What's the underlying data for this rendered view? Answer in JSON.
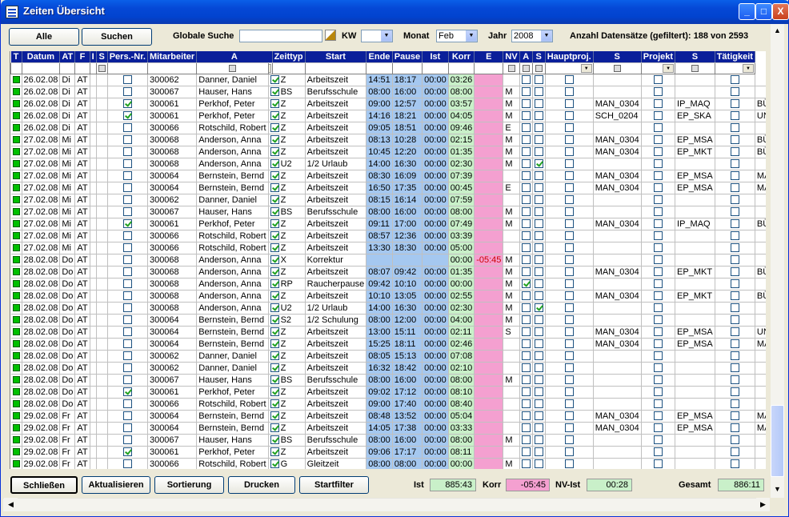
{
  "window": {
    "title": "Zeiten Übersicht",
    "minimize": "_",
    "maximize": "□",
    "close": "X"
  },
  "toolbar": {
    "alle": "Alle",
    "suchen": "Suchen",
    "global_search_label": "Globale Suche",
    "global_search_value": "",
    "kw_label": "KW",
    "kw_value": "",
    "monat_label": "Monat",
    "monat_value": "Feb",
    "jahr_label": "Jahr",
    "jahr_value": "2008",
    "count_text": "Anzahl Datensätze (gefiltert): 188 von 2593"
  },
  "columns": [
    "T",
    "Datum",
    "AT",
    "F",
    "I",
    "S",
    "Pers.-Nr.",
    "Mitarbeiter",
    "A",
    "",
    "Zeittyp",
    "Start",
    "Ende",
    "Pause",
    "Ist",
    "Korr",
    "E",
    "NV",
    "A",
    "S",
    "Hauptproj.",
    "S",
    "Projekt",
    "S",
    "Tätigkeit"
  ],
  "rows": [
    [
      "26.02.08",
      "Di",
      "AT",
      "",
      false,
      "300062",
      "Danner, Daniel",
      true,
      "Z",
      "Arbeitszeit",
      "14:51",
      "18:17",
      "00:00",
      "03:26",
      "",
      "",
      false,
      false,
      false,
      "",
      false,
      "",
      false,
      ""
    ],
    [
      "26.02.08",
      "Di",
      "AT",
      "",
      false,
      "300067",
      "Hauser, Hans",
      true,
      "BS",
      "Berufsschule",
      "08:00",
      "16:00",
      "00:00",
      "08:00",
      "",
      "M",
      false,
      false,
      false,
      "",
      false,
      "",
      false,
      ""
    ],
    [
      "26.02.08",
      "Di",
      "AT",
      "",
      true,
      "300061",
      "Perkhof, Peter",
      true,
      "Z",
      "Arbeitszeit",
      "09:00",
      "12:57",
      "00:00",
      "03:57",
      "",
      "M",
      false,
      false,
      false,
      "MAN_0304",
      false,
      "IP_MAQ",
      false,
      "BÜRO"
    ],
    [
      "26.02.08",
      "Di",
      "AT",
      "",
      true,
      "300061",
      "Perkhof, Peter",
      true,
      "Z",
      "Arbeitszeit",
      "14:16",
      "18:21",
      "00:00",
      "04:05",
      "",
      "M",
      false,
      false,
      false,
      "SCH_0204",
      false,
      "EP_SKA",
      false,
      "UNP"
    ],
    [
      "26.02.08",
      "Di",
      "AT",
      "",
      false,
      "300066",
      "Rotschild, Robert",
      true,
      "Z",
      "Arbeitszeit",
      "09:05",
      "18:51",
      "00:00",
      "09:46",
      "",
      "E",
      false,
      false,
      false,
      "",
      false,
      "",
      false,
      ""
    ],
    [
      "27.02.08",
      "Mi",
      "AT",
      "",
      false,
      "300068",
      "Anderson, Anna",
      true,
      "Z",
      "Arbeitszeit",
      "08:13",
      "10:28",
      "00:00",
      "02:15",
      "",
      "M",
      false,
      false,
      false,
      "MAN_0304",
      false,
      "EP_MSA",
      false,
      "BÜRO"
    ],
    [
      "27.02.08",
      "Mi",
      "AT",
      "",
      false,
      "300068",
      "Anderson, Anna",
      true,
      "Z",
      "Arbeitszeit",
      "10:45",
      "12:20",
      "00:00",
      "01:35",
      "",
      "M",
      false,
      false,
      false,
      "MAN_0304",
      false,
      "EP_MKT",
      false,
      "BÜRO"
    ],
    [
      "27.02.08",
      "Mi",
      "AT",
      "",
      false,
      "300068",
      "Anderson, Anna",
      true,
      "U2",
      "1/2 Urlaub",
      "14:00",
      "16:30",
      "00:00",
      "02:30",
      "",
      "M",
      false,
      true,
      false,
      "",
      false,
      "",
      false,
      ""
    ],
    [
      "27.02.08",
      "Mi",
      "AT",
      "",
      false,
      "300064",
      "Bernstein, Bernd",
      true,
      "Z",
      "Arbeitszeit",
      "08:30",
      "16:09",
      "00:00",
      "07:39",
      "",
      "",
      false,
      false,
      false,
      "MAN_0304",
      false,
      "EP_MSA",
      false,
      "MAN"
    ],
    [
      "27.02.08",
      "Mi",
      "AT",
      "",
      false,
      "300064",
      "Bernstein, Bernd",
      true,
      "Z",
      "Arbeitszeit",
      "16:50",
      "17:35",
      "00:00",
      "00:45",
      "",
      "E",
      false,
      false,
      false,
      "MAN_0304",
      false,
      "EP_MSA",
      false,
      "MAN"
    ],
    [
      "27.02.08",
      "Mi",
      "AT",
      "",
      false,
      "300062",
      "Danner, Daniel",
      true,
      "Z",
      "Arbeitszeit",
      "08:15",
      "16:14",
      "00:00",
      "07:59",
      "",
      "",
      false,
      false,
      false,
      "",
      false,
      "",
      false,
      ""
    ],
    [
      "27.02.08",
      "Mi",
      "AT",
      "",
      false,
      "300067",
      "Hauser, Hans",
      true,
      "BS",
      "Berufsschule",
      "08:00",
      "16:00",
      "00:00",
      "08:00",
      "",
      "M",
      false,
      false,
      false,
      "",
      false,
      "",
      false,
      ""
    ],
    [
      "27.02.08",
      "Mi",
      "AT",
      "",
      true,
      "300061",
      "Perkhof, Peter",
      true,
      "Z",
      "Arbeitszeit",
      "09:11",
      "17:00",
      "00:00",
      "07:49",
      "",
      "M",
      false,
      false,
      false,
      "MAN_0304",
      false,
      "IP_MAQ",
      false,
      "BÜRO"
    ],
    [
      "27.02.08",
      "Mi",
      "AT",
      "",
      false,
      "300066",
      "Rotschild, Robert",
      true,
      "Z",
      "Arbeitszeit",
      "08:57",
      "12:36",
      "00:00",
      "03:39",
      "",
      "",
      false,
      false,
      false,
      "",
      false,
      "",
      false,
      ""
    ],
    [
      "27.02.08",
      "Mi",
      "AT",
      "",
      false,
      "300066",
      "Rotschild, Robert",
      true,
      "Z",
      "Arbeitszeit",
      "13:30",
      "18:30",
      "00:00",
      "05:00",
      "",
      "",
      false,
      false,
      false,
      "",
      false,
      "",
      false,
      ""
    ],
    [
      "28.02.08",
      "Do",
      "AT",
      "",
      false,
      "300068",
      "Anderson, Anna",
      true,
      "X",
      "Korrektur",
      "",
      "",
      "",
      "00:00",
      "-05:45",
      "M",
      false,
      false,
      false,
      "",
      false,
      "",
      false,
      ""
    ],
    [
      "28.02.08",
      "Do",
      "AT",
      "",
      false,
      "300068",
      "Anderson, Anna",
      true,
      "Z",
      "Arbeitszeit",
      "08:07",
      "09:42",
      "00:00",
      "01:35",
      "",
      "M",
      false,
      false,
      false,
      "MAN_0304",
      false,
      "EP_MKT",
      false,
      "BÜRO"
    ],
    [
      "28.02.08",
      "Do",
      "AT",
      "",
      false,
      "300068",
      "Anderson, Anna",
      true,
      "RP",
      "Raucherpause",
      "09:42",
      "10:10",
      "00:00",
      "00:00",
      "",
      "M",
      true,
      false,
      false,
      "",
      false,
      "",
      false,
      ""
    ],
    [
      "28.02.08",
      "Do",
      "AT",
      "",
      false,
      "300068",
      "Anderson, Anna",
      true,
      "Z",
      "Arbeitszeit",
      "10:10",
      "13:05",
      "00:00",
      "02:55",
      "",
      "M",
      false,
      false,
      false,
      "MAN_0304",
      false,
      "EP_MKT",
      false,
      "BÜRO"
    ],
    [
      "28.02.08",
      "Do",
      "AT",
      "",
      false,
      "300068",
      "Anderson, Anna",
      true,
      "U2",
      "1/2 Urlaub",
      "14:00",
      "16:30",
      "00:00",
      "02:30",
      "",
      "M",
      false,
      true,
      false,
      "",
      false,
      "",
      false,
      ""
    ],
    [
      "28.02.08",
      "Do",
      "AT",
      "",
      false,
      "300064",
      "Bernstein, Bernd",
      true,
      "S2",
      "1/2 Schulung",
      "08:00",
      "12:00",
      "00:00",
      "04:00",
      "",
      "M",
      false,
      false,
      false,
      "",
      false,
      "",
      false,
      ""
    ],
    [
      "28.02.08",
      "Do",
      "AT",
      "",
      false,
      "300064",
      "Bernstein, Bernd",
      true,
      "Z",
      "Arbeitszeit",
      "13:00",
      "15:11",
      "00:00",
      "02:11",
      "",
      "S",
      false,
      false,
      false,
      "MAN_0304",
      false,
      "EP_MSA",
      false,
      "UNP"
    ],
    [
      "28.02.08",
      "Do",
      "AT",
      "",
      false,
      "300064",
      "Bernstein, Bernd",
      true,
      "Z",
      "Arbeitszeit",
      "15:25",
      "18:11",
      "00:00",
      "02:46",
      "",
      "",
      false,
      false,
      false,
      "MAN_0304",
      false,
      "EP_MSA",
      false,
      "MAN"
    ],
    [
      "28.02.08",
      "Do",
      "AT",
      "",
      false,
      "300062",
      "Danner, Daniel",
      true,
      "Z",
      "Arbeitszeit",
      "08:05",
      "15:13",
      "00:00",
      "07:08",
      "",
      "",
      false,
      false,
      false,
      "",
      false,
      "",
      false,
      ""
    ],
    [
      "28.02.08",
      "Do",
      "AT",
      "",
      false,
      "300062",
      "Danner, Daniel",
      true,
      "Z",
      "Arbeitszeit",
      "16:32",
      "18:42",
      "00:00",
      "02:10",
      "",
      "",
      false,
      false,
      false,
      "",
      false,
      "",
      false,
      ""
    ],
    [
      "28.02.08",
      "Do",
      "AT",
      "",
      false,
      "300067",
      "Hauser, Hans",
      true,
      "BS",
      "Berufsschule",
      "08:00",
      "16:00",
      "00:00",
      "08:00",
      "",
      "M",
      false,
      false,
      false,
      "",
      false,
      "",
      false,
      ""
    ],
    [
      "28.02.08",
      "Do",
      "AT",
      "",
      true,
      "300061",
      "Perkhof, Peter",
      true,
      "Z",
      "Arbeitszeit",
      "09:02",
      "17:12",
      "00:00",
      "08:10",
      "",
      "",
      false,
      false,
      false,
      "",
      false,
      "",
      false,
      ""
    ],
    [
      "28.02.08",
      "Do",
      "AT",
      "",
      false,
      "300066",
      "Rotschild, Robert",
      true,
      "Z",
      "Arbeitszeit",
      "09:00",
      "17:40",
      "00:00",
      "08:40",
      "",
      "",
      false,
      false,
      false,
      "",
      false,
      "",
      false,
      ""
    ],
    [
      "29.02.08",
      "Fr",
      "AT",
      "",
      false,
      "300064",
      "Bernstein, Bernd",
      true,
      "Z",
      "Arbeitszeit",
      "08:48",
      "13:52",
      "00:00",
      "05:04",
      "",
      "",
      false,
      false,
      false,
      "MAN_0304",
      false,
      "EP_MSA",
      false,
      "MAN"
    ],
    [
      "29.02.08",
      "Fr",
      "AT",
      "",
      false,
      "300064",
      "Bernstein, Bernd",
      true,
      "Z",
      "Arbeitszeit",
      "14:05",
      "17:38",
      "00:00",
      "03:33",
      "",
      "",
      false,
      false,
      false,
      "MAN_0304",
      false,
      "EP_MSA",
      false,
      "MAN"
    ],
    [
      "29.02.08",
      "Fr",
      "AT",
      "",
      false,
      "300067",
      "Hauser, Hans",
      true,
      "BS",
      "Berufsschule",
      "08:00",
      "16:00",
      "00:00",
      "08:00",
      "",
      "M",
      false,
      false,
      false,
      "",
      false,
      "",
      false,
      ""
    ],
    [
      "29.02.08",
      "Fr",
      "AT",
      "",
      true,
      "300061",
      "Perkhof, Peter",
      true,
      "Z",
      "Arbeitszeit",
      "09:06",
      "17:17",
      "00:00",
      "08:11",
      "",
      "",
      false,
      false,
      false,
      "",
      false,
      "",
      false,
      ""
    ],
    [
      "29.02.08",
      "Fr",
      "AT",
      "",
      false,
      "300066",
      "Rotschild, Robert",
      true,
      "G",
      "Gleitzeit",
      "08:00",
      "08:00",
      "00:00",
      "00:00",
      "",
      "M",
      false,
      false,
      false,
      "",
      false,
      "",
      false,
      ""
    ]
  ],
  "extra_col_marks": {
    "7": "2",
    "19": "2"
  },
  "footer": {
    "close": "Schließen",
    "refresh": "Aktualisieren",
    "sort": "Sortierung",
    "print": "Drucken",
    "startfilter": "Startfilter",
    "ist_label": "Ist",
    "ist_value": "885:43",
    "korr_label": "Korr",
    "korr_value": "-05:45",
    "nvist_label": "NV-Ist",
    "nvist_value": "00:28",
    "gesamt_label": "Gesamt",
    "gesamt_value": "886:11"
  },
  "colors": {
    "status_green": "#00c000",
    "header_blue": "#0a1f9a",
    "time_blue": "#a5c8f0",
    "ist_green": "#c9f0c9",
    "korr_pink": "#f4a0d0"
  }
}
